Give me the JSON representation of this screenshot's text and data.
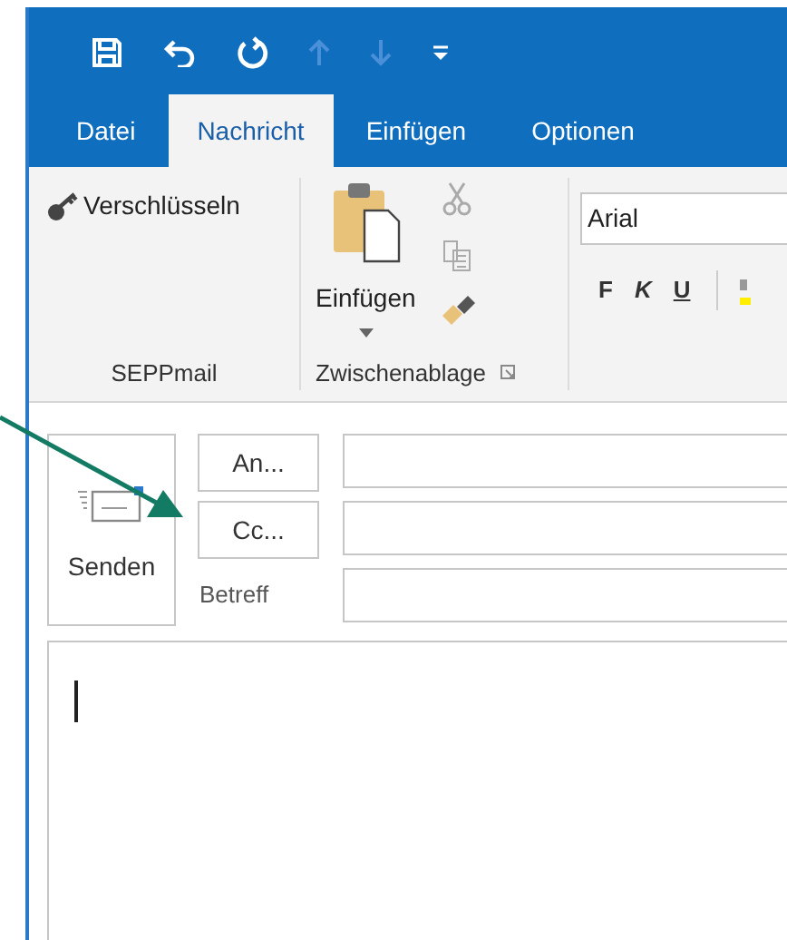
{
  "quick_access": [
    {
      "kind": "save",
      "disabled": false
    },
    {
      "kind": "undo",
      "disabled": false
    },
    {
      "kind": "redo",
      "disabled": false
    },
    {
      "kind": "up",
      "disabled": true
    },
    {
      "kind": "down",
      "disabled": true
    },
    {
      "kind": "customize",
      "disabled": false
    }
  ],
  "tabs": [
    {
      "label": "Datei",
      "selected": false
    },
    {
      "label": "Nachricht",
      "selected": true
    },
    {
      "label": "Einfügen",
      "selected": false
    },
    {
      "label": "Optionen",
      "selected": false
    }
  ],
  "ribbon": {
    "seppmail": {
      "encrypt_button": "Verschlüsseln",
      "group_label": "SEPPmail"
    },
    "clipboard": {
      "paste_button": "Einfügen",
      "group_label": "Zwischenablage"
    },
    "font": {
      "font_name": "Arial",
      "format_buttons": [
        "F",
        "K",
        "U"
      ]
    }
  },
  "compose": {
    "send_button": "Senden",
    "to_button": "An...",
    "cc_button": "Cc...",
    "subject_label": "Betreff"
  }
}
